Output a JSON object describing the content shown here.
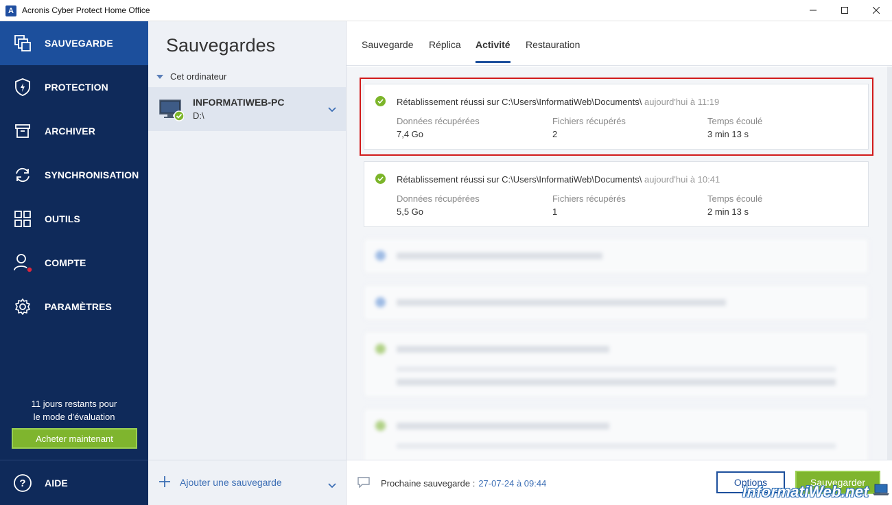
{
  "window": {
    "title": "Acronis Cyber Protect Home Office",
    "app_icon_letter": "A"
  },
  "sidebar": {
    "items": [
      {
        "label": "SAUVEGARDE",
        "icon": "backup-icon",
        "active": true
      },
      {
        "label": "PROTECTION",
        "icon": "shield-icon",
        "active": false
      },
      {
        "label": "ARCHIVER",
        "icon": "archive-icon",
        "active": false
      },
      {
        "label": "SYNCHRONISATION",
        "icon": "sync-icon",
        "active": false
      },
      {
        "label": "OUTILS",
        "icon": "tools-grid-icon",
        "active": false
      },
      {
        "label": "COMPTE",
        "icon": "account-icon",
        "active": false
      },
      {
        "label": "PARAMÈTRES",
        "icon": "gear-icon",
        "active": false
      }
    ],
    "trial_line1": "11 jours restants pour",
    "trial_line2": "le mode d'évaluation",
    "buy_label": "Acheter maintenant",
    "help_label": "AIDE"
  },
  "middle": {
    "title": "Sauvegardes",
    "category": "Cet ordinateur",
    "backup": {
      "name": "INFORMATIWEB-PC",
      "drive": "D:\\"
    },
    "add_label": "Ajouter une sauvegarde"
  },
  "tabs": [
    {
      "label": "Sauvegarde",
      "active": false
    },
    {
      "label": "Réplica",
      "active": false
    },
    {
      "label": "Activité",
      "active": true
    },
    {
      "label": "Restauration",
      "active": false
    }
  ],
  "activities": [
    {
      "title": "Rétablissement réussi sur C:\\Users\\InformatiWeb\\Documents\\",
      "time": "aujourd'hui à 11:19",
      "cols": [
        {
          "label": "Données récupérées",
          "value": "7,4 Go"
        },
        {
          "label": "Fichiers récupérés",
          "value": "2"
        },
        {
          "label": "Temps écoulé",
          "value": "3 min 13 s"
        }
      ]
    },
    {
      "title": "Rétablissement réussi sur C:\\Users\\InformatiWeb\\Documents\\",
      "time": "aujourd'hui à 10:41",
      "cols": [
        {
          "label": "Données récupérées",
          "value": "5,5 Go"
        },
        {
          "label": "Fichiers récupérés",
          "value": "1"
        },
        {
          "label": "Temps écoulé",
          "value": "2 min 13 s"
        }
      ]
    }
  ],
  "footer": {
    "next_label": "Prochaine sauvegarde :",
    "next_value": "27-07-24 à 09:44",
    "options_label": "Options",
    "save_label": "Sauvegarder"
  },
  "watermark": "InformatiWeb.net",
  "colors": {
    "sidebar": "#0f2a5a",
    "active": "#1c4f9c",
    "accent_green": "#7fb52e",
    "link": "#3d6fb5",
    "highlight": "#d11a1a"
  }
}
